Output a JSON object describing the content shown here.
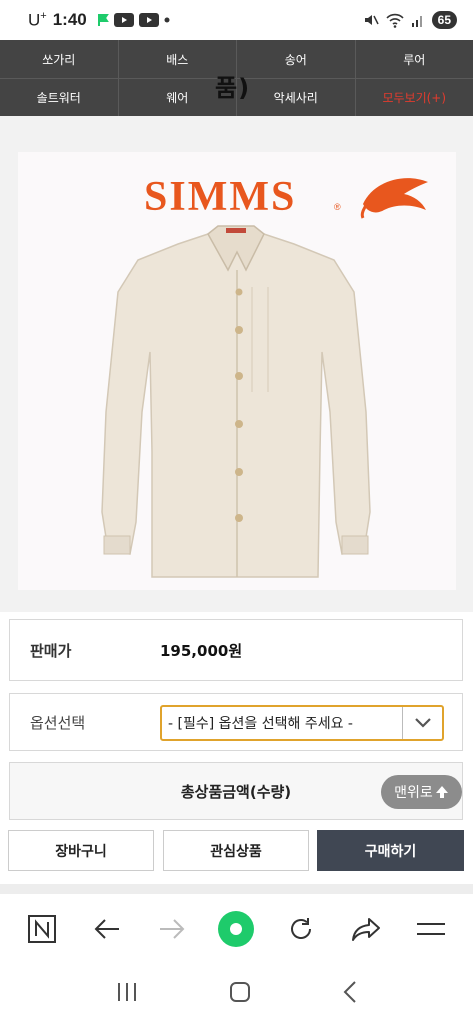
{
  "status": {
    "carrier": "U",
    "carrier_sup": "+",
    "time": "1:40",
    "battery": "65"
  },
  "categories": {
    "row1": [
      "쏘가리",
      "배스",
      "송어",
      "루어"
    ],
    "row2": [
      "솔트워터",
      "웨어",
      "악세사리",
      "모두보기(+)"
    ]
  },
  "overlay_title": "품)",
  "product": {
    "brand": "SIMMS",
    "brand_mark": "®",
    "brand_color": "#e8571e",
    "image_desc": "shirt-image"
  },
  "price": {
    "label": "판매가",
    "value": "195,000원"
  },
  "option": {
    "label": "옵션선택",
    "selected": "- [필수] 옵션을 선택해 주세요 -"
  },
  "total": {
    "label": "총상품금액(수량)"
  },
  "top_button": {
    "label": "맨위로"
  },
  "actions": {
    "cart": "장바구니",
    "wishlist": "관심상품",
    "buy": "구매하기"
  },
  "colors": {
    "nav_bg": "#444444",
    "accent_red": "#e23b2e",
    "select_border": "#e0a32c",
    "buy_bg": "#404753",
    "home_green": "#1ecb6b"
  }
}
